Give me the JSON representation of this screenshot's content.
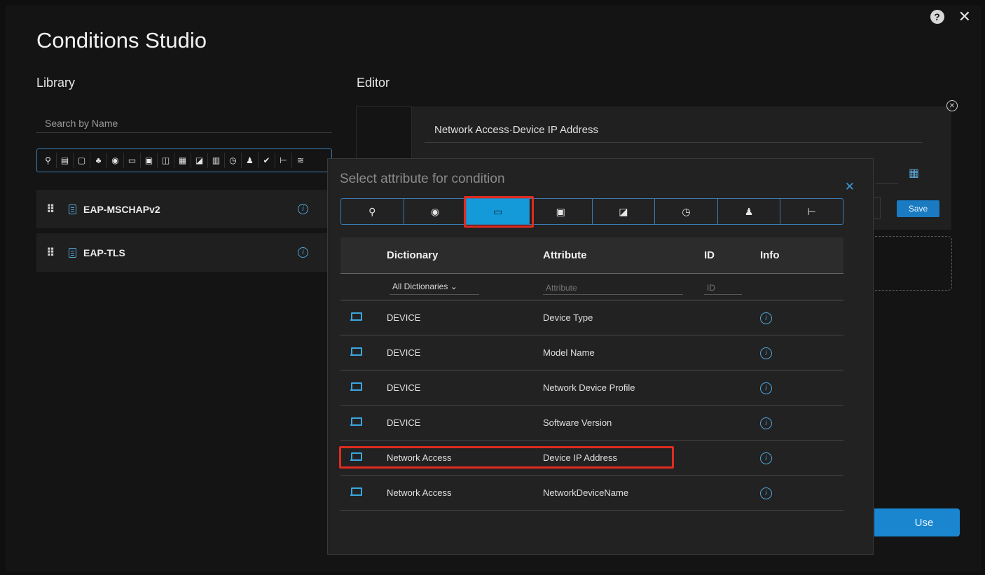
{
  "window": {
    "title": "Conditions Studio",
    "help_glyph": "?",
    "close_glyph": "✕"
  },
  "library": {
    "label": "Library",
    "search_placeholder": "Search by Name",
    "filter_icons": [
      "location-icon",
      "card-icon",
      "square-icon",
      "group-icon",
      "globe-icon",
      "monitor-icon",
      "display-icon",
      "network-icon",
      "screen-icon",
      "edit-icon",
      "building-icon",
      "clock-icon",
      "user-icon",
      "check-icon",
      "hierarchy-icon",
      "wifi-icon"
    ],
    "items": [
      {
        "label": "EAP-MSCHAPv2"
      },
      {
        "label": "EAP-TLS"
      }
    ]
  },
  "editor": {
    "label": "Editor",
    "attribute_value": "Network Access·Device IP Address",
    "save_label": "Save",
    "use_label": "Use"
  },
  "popup": {
    "title": "Select attribute for condition",
    "close_glyph": "✕",
    "tabs": [
      {
        "icon": "location-icon",
        "glyph": "⚲"
      },
      {
        "icon": "globe-icon",
        "glyph": "◉"
      },
      {
        "icon": "monitor-icon",
        "glyph": "▭",
        "active": true
      },
      {
        "icon": "card-icon",
        "glyph": "▣"
      },
      {
        "icon": "edit-icon",
        "glyph": "◪"
      },
      {
        "icon": "clock-icon",
        "glyph": "◷"
      },
      {
        "icon": "user-icon",
        "glyph": "♟"
      },
      {
        "icon": "hierarchy-icon",
        "glyph": "⊢"
      }
    ],
    "table": {
      "headers": {
        "dictionary": "Dictionary",
        "attribute": "Attribute",
        "id": "ID",
        "info": "Info"
      },
      "filters": {
        "dictionary": "All Dictionaries",
        "attribute": "Attribute",
        "id": "ID"
      },
      "rows": [
        {
          "dictionary": "DEVICE",
          "attribute": "Device Type"
        },
        {
          "dictionary": "DEVICE",
          "attribute": "Model Name"
        },
        {
          "dictionary": "DEVICE",
          "attribute": "Network Device Profile"
        },
        {
          "dictionary": "DEVICE",
          "attribute": "Software Version"
        },
        {
          "dictionary": "Network Access",
          "attribute": "Device IP Address",
          "highlighted": true
        },
        {
          "dictionary": "Network Access",
          "attribute": "NetworkDeviceName"
        }
      ]
    }
  },
  "colors": {
    "accent": "#149ad8",
    "highlight": "#e02b20",
    "background": "#141414"
  }
}
